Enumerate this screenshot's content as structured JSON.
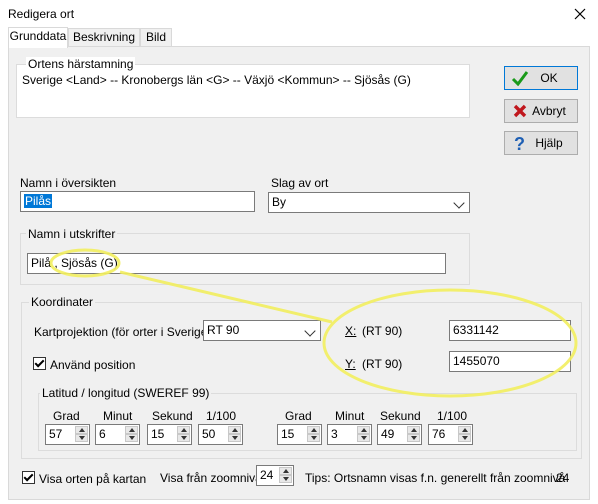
{
  "window": {
    "title": "Redigera ort"
  },
  "tabs": [
    "Grunddata",
    "Beskrivning",
    "Bild"
  ],
  "origin": {
    "label": "Ortens härstamning",
    "value": "Sverige <Land> -- Kronobergs län <G> -- Växjö <Kommun> -- Sjösås (G)"
  },
  "buttons": {
    "ok": "OK",
    "cancel": "Avbryt",
    "help": "Hjälp"
  },
  "name_overview": {
    "label": "Namn i översikten",
    "value": "Pilås"
  },
  "place_type": {
    "label": "Slag av ort",
    "value": "By"
  },
  "name_printouts": {
    "label": "Namn i utskrifter",
    "value": "Pilå , Sjösås (G)"
  },
  "coordinates": {
    "label": "Koordinater",
    "projection_label": "Kartprojektion (för orter i Sverige)",
    "projection_value": "RT 90",
    "use_position": "Använd position",
    "x_label": "X:",
    "x_unit": "(RT 90)",
    "x_value": "6331142",
    "y_label": "Y:",
    "y_unit": "(RT 90)",
    "y_value": "1455070"
  },
  "latlon": {
    "label": "Latitud / longitud (SWEREF 99)",
    "headers": [
      "Grad",
      "Minut",
      "Sekund",
      "1/100"
    ],
    "lat": [
      "57",
      "6",
      "15",
      "50"
    ],
    "lon": [
      "15",
      "3",
      "49",
      "76"
    ]
  },
  "footer": {
    "show_on_map": "Visa orten på kartan",
    "zoom_label": "Visa från zoomnivå",
    "zoom_value": "24",
    "tip": "Tips: Ortsnamn visas f.n. generellt från  zoomnivå",
    "tip_value": "24"
  },
  "colors": {
    "highlight": "#f2ee5e",
    "accent": "#0078d7"
  }
}
